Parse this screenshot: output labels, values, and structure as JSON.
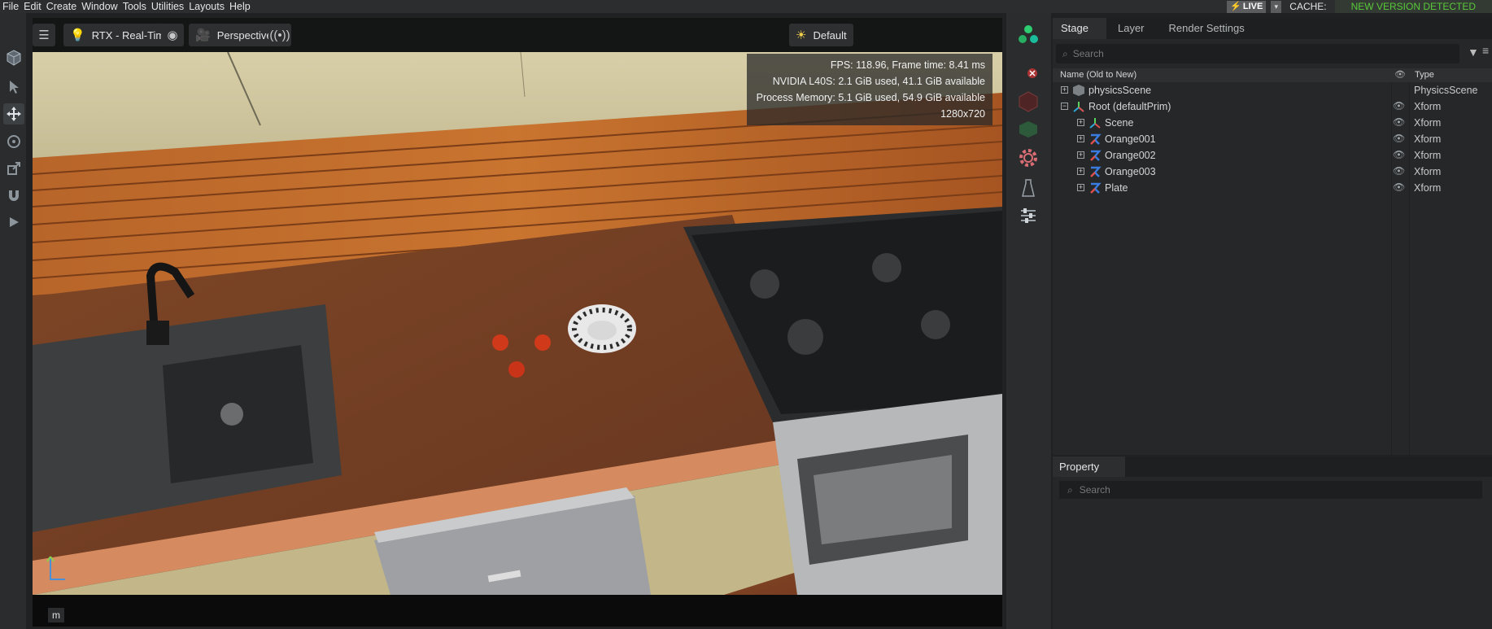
{
  "menubar": {
    "items": [
      "File",
      "Edit",
      "Create",
      "Window",
      "Tools",
      "Utilities",
      "Layouts",
      "Help"
    ],
    "live_label": "LIVE",
    "cache_label": "CACHE:",
    "new_version": "NEW VERSION DETECTED"
  },
  "viewport": {
    "renderer_label": "RTX - Real-Time",
    "camera_label": "Perspective",
    "lighting_label": "Default",
    "stats": {
      "fps": "FPS: 118.96, Frame time: 8.41 ms",
      "gpu": "NVIDIA L40S: 2.1 GiB used, 41.1 GiB available",
      "memory": "Process Memory: 5.1 GiB used, 54.9 GiB available",
      "resolution": "1280x720"
    },
    "key_hint": "m"
  },
  "stage": {
    "tabs": [
      "Stage",
      "Layer",
      "Render Settings"
    ],
    "search_placeholder": "Search",
    "col_name": "Name (Old to New)",
    "col_type": "Type",
    "rows": [
      {
        "name": "physicsScene",
        "type": "PhysicsScene"
      },
      {
        "name": "Root (defaultPrim)",
        "type": "Xform"
      },
      {
        "name": "Scene",
        "type": "Xform"
      },
      {
        "name": "Orange001",
        "type": "Xform"
      },
      {
        "name": "Orange002",
        "type": "Xform"
      },
      {
        "name": "Orange003",
        "type": "Xform"
      },
      {
        "name": "Plate",
        "type": "Xform"
      }
    ]
  },
  "property": {
    "tab": "Property",
    "search_placeholder": "Search"
  },
  "colors": {
    "accent_green": "#58c83a",
    "live_bolt": "#ffd000",
    "xform_icon": "#3a7be0"
  }
}
